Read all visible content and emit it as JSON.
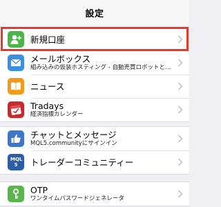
{
  "navbar": {
    "title": "設定"
  },
  "rows": {
    "new_account": {
      "label": "新規口座",
      "icon": "add-user-icon",
      "color": "#4cb44a"
    },
    "mailbox": {
      "label": "メールボックス",
      "sub": "組み込みの仮装ホスティング - 自動売買ロボットと…",
      "icon": "mail-icon",
      "color": "#3a8fe0"
    },
    "news": {
      "label": "ニュース",
      "icon": "book-icon",
      "color": "#f39a1c"
    },
    "tradays": {
      "label": "Tradays",
      "sub": "経済指標カレンダー",
      "icon": "tradays-icon",
      "color": "#c8282e"
    },
    "chat": {
      "label": "チャットとメッセージ",
      "sub": "MQL5.communityにサインイン",
      "icon": "thumbs-up-icon",
      "color": "#3c77c9"
    },
    "community": {
      "label": "トレーダーコミュニティー",
      "icon": "mql5-icon",
      "icon_text": "MQL 5",
      "color": "#2a5ea8"
    },
    "otp": {
      "label": "OTP",
      "sub": "ワンタイムパスワードジェネレータ",
      "icon": "key-icon",
      "color": "#5ab54c"
    }
  },
  "colors": {
    "highlight": "#e8382a",
    "background": "#efeff4"
  }
}
